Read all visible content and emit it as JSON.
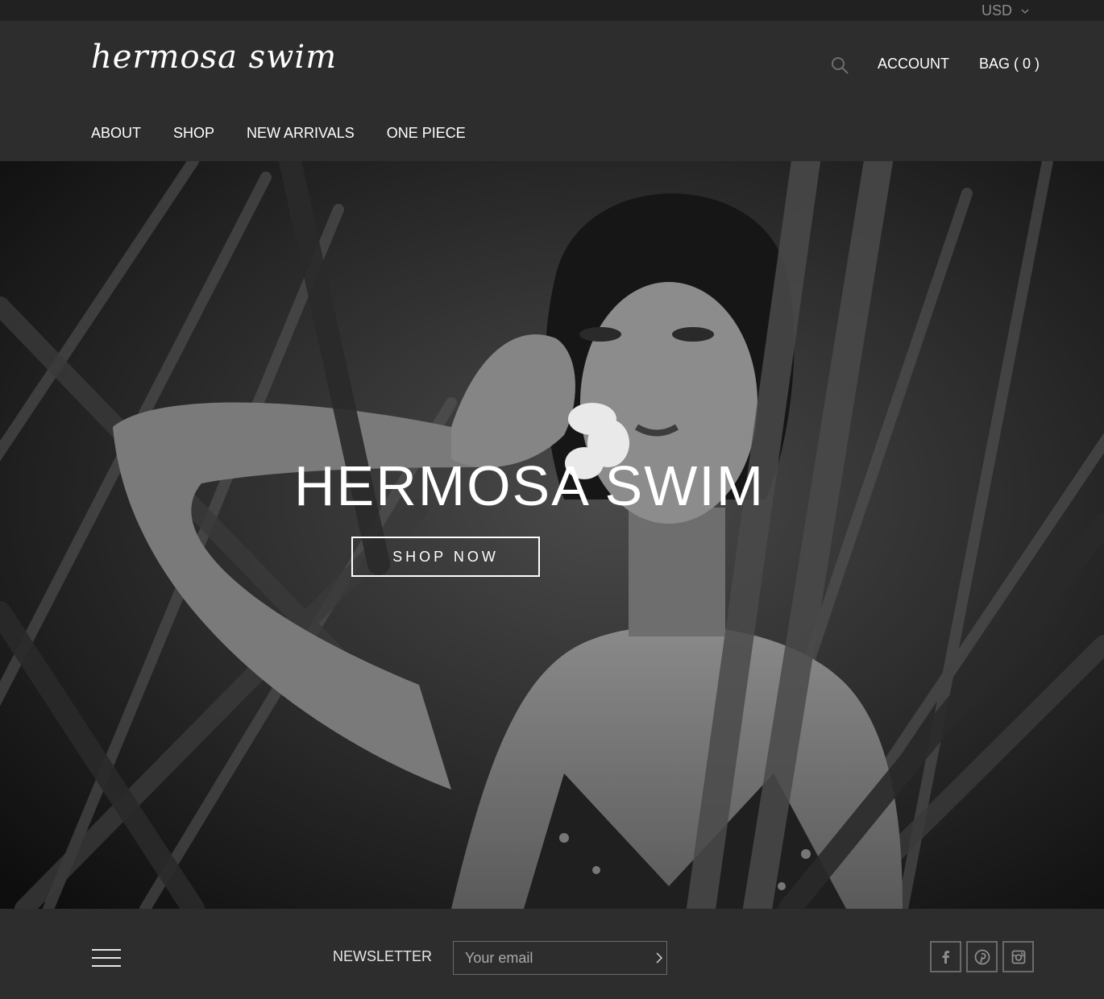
{
  "topbar": {
    "currency": "USD"
  },
  "header": {
    "logo": "hermosa swim",
    "account_label": "ACCOUNT",
    "bag_label": "BAG ( 0 )"
  },
  "nav": {
    "items": [
      {
        "label": "ABOUT"
      },
      {
        "label": "SHOP"
      },
      {
        "label": "NEW ARRIVALS"
      },
      {
        "label": "ONE PIECE"
      }
    ]
  },
  "hero": {
    "title": "HERMOSA SWIM",
    "cta_label": "SHOP NOW"
  },
  "footer": {
    "newsletter_label": "NEWSLETTER",
    "email_placeholder": "Your email",
    "social": [
      {
        "icon": "facebook-icon"
      },
      {
        "icon": "pinterest-icon"
      },
      {
        "icon": "instagram-icon"
      }
    ]
  },
  "colors": {
    "header_bg": "#2e2d2e",
    "topbar_bg": "#212121",
    "text": "#ffffff",
    "muted": "#8c8c8c"
  }
}
